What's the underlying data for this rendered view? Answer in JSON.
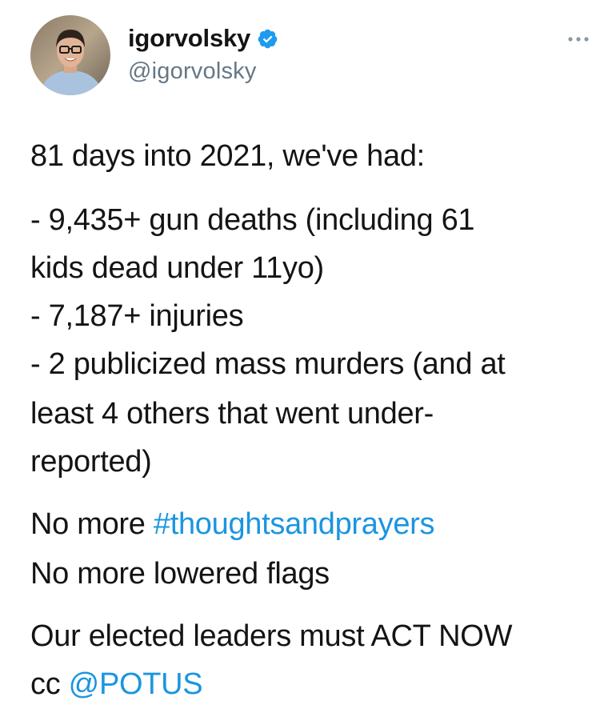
{
  "author": {
    "display_name": "igorvolsky",
    "handle": "@igorvolsky",
    "verified": true,
    "avatar_icon": "profile-photo-icon",
    "verified_icon": "verified-badge-icon",
    "more_icon": "more-options-icon"
  },
  "tweet": {
    "intro": "81 days into 2021, we've had:",
    "lines": [
      "- 9,435+ gun deaths (including 61",
      "kids dead under 11yo)",
      "- 7,187+ injuries",
      "- 2 publicized mass murders (and at",
      "least 4 others that went under-",
      "reported)"
    ],
    "no_more_prefix": "No more ",
    "hashtag": "#thoughtsandprayers",
    "no_more_flags": "No more lowered flags",
    "call_to_action": "Our elected leaders must ACT NOW",
    "cc_prefix": "cc ",
    "mention": "@POTUS"
  },
  "colors": {
    "link": "#1b95e0",
    "verified": "#1d9bf0",
    "text": "#141414",
    "secondary": "#657786"
  }
}
